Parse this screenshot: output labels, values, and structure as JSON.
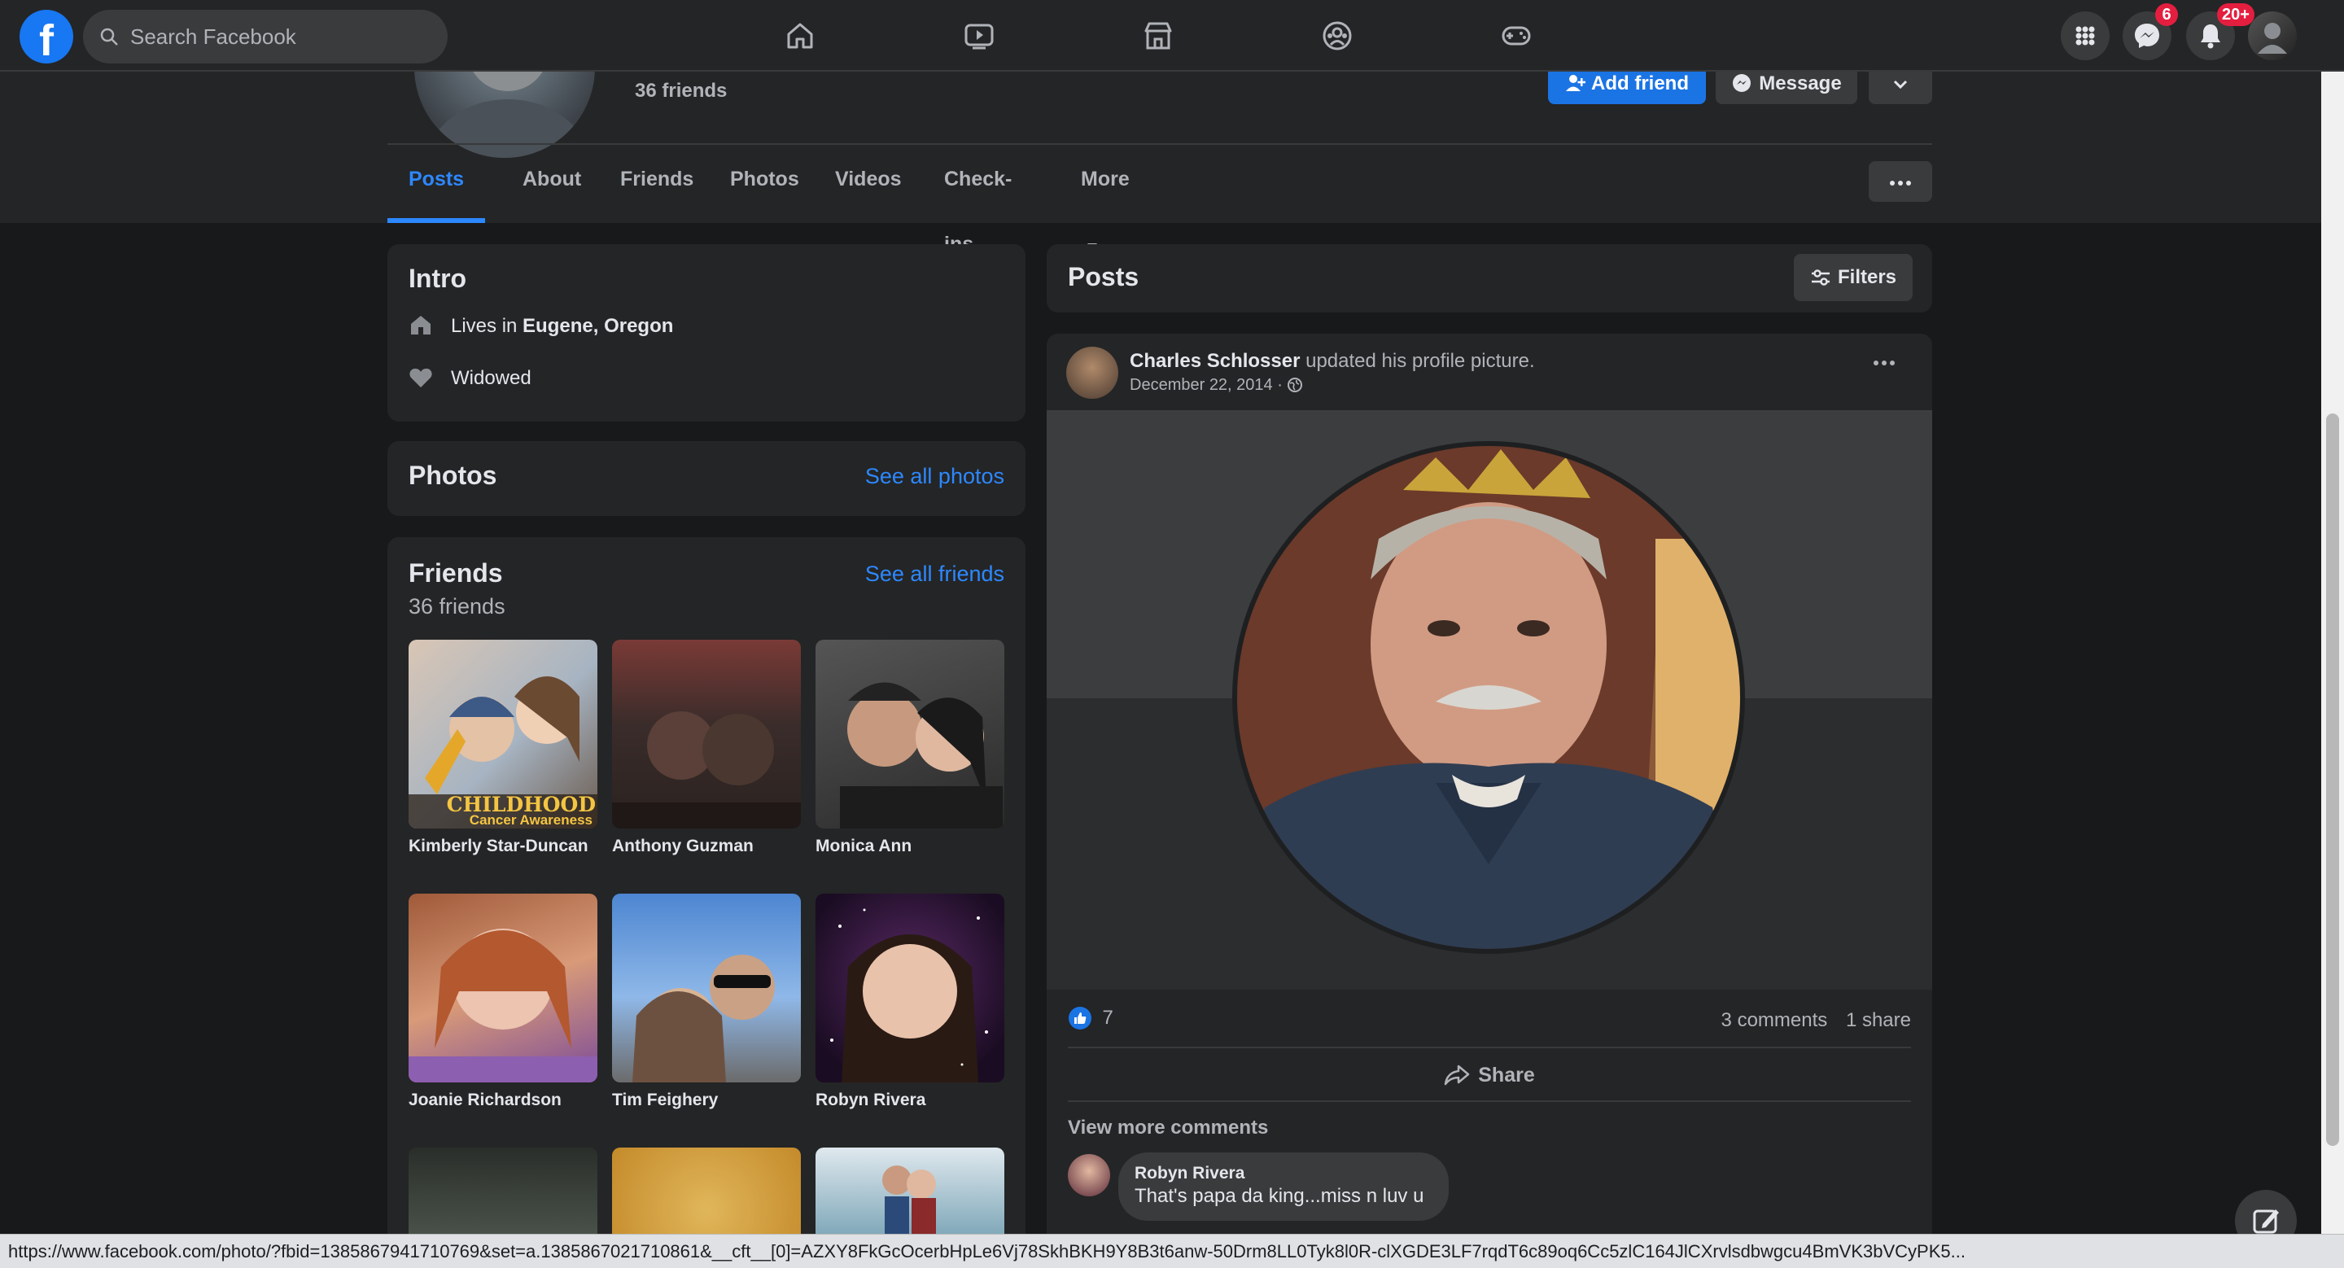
{
  "topbar": {
    "logo_letter": "f",
    "search_placeholder": "Search Facebook",
    "nav_icons": [
      "home-icon",
      "watch-icon",
      "marketplace-icon",
      "groups-icon",
      "gaming-icon"
    ],
    "messenger_badge": "6",
    "notifications_badge": "20+"
  },
  "profile": {
    "friends_count": "36 friends",
    "add_friend_label": "Add friend",
    "message_label": "Message",
    "tabs": [
      "Posts",
      "About",
      "Friends",
      "Photos",
      "Videos",
      "Check-ins",
      "More"
    ],
    "active_tab": "Posts"
  },
  "intro": {
    "title": "Intro",
    "lives_prefix": "Lives in ",
    "lives_city": "Eugene, Oregon",
    "relationship": "Widowed"
  },
  "photos": {
    "title": "Photos",
    "see_all": "See all photos"
  },
  "friends": {
    "title": "Friends",
    "count": "36 friends",
    "see_all": "See all friends",
    "list": [
      {
        "name": "Kimberly Star-Duncan",
        "overlay_text_1": "CHILDHOOD",
        "overlay_text_2": "Cancer Awareness"
      },
      {
        "name": "Anthony Guzman"
      },
      {
        "name": "Monica Ann"
      },
      {
        "name": "Joanie Richardson"
      },
      {
        "name": "Tim Feighery"
      },
      {
        "name": "Robyn Rivera"
      }
    ]
  },
  "posts": {
    "title": "Posts",
    "filters_label": "Filters",
    "post": {
      "author": "Charles Schlosser",
      "action": " updated his profile picture.",
      "date": "December 22, 2014 · ",
      "likes": "7",
      "comments": "3 comments",
      "shares": "1 share",
      "share_label": "Share",
      "view_more_comments": "View more comments",
      "comment": {
        "author": "Robyn Rivera",
        "text": "That's papa da king...miss n luv u"
      }
    }
  },
  "status_url": "https://www.facebook.com/photo/?fbid=1385867941710769&set=a.1385867021710861&__cft__[0]=AZXY8FkGcOcerbHpLe6Vj78SkhBKH9Y8B3t6anw-50Drm8LL0Tyk8l0R-clXGDE3LF7rqdT6c89oq6Cc5zlC164JlCXrvlsdbwgcu4BmVK3bVCyPK5..."
}
